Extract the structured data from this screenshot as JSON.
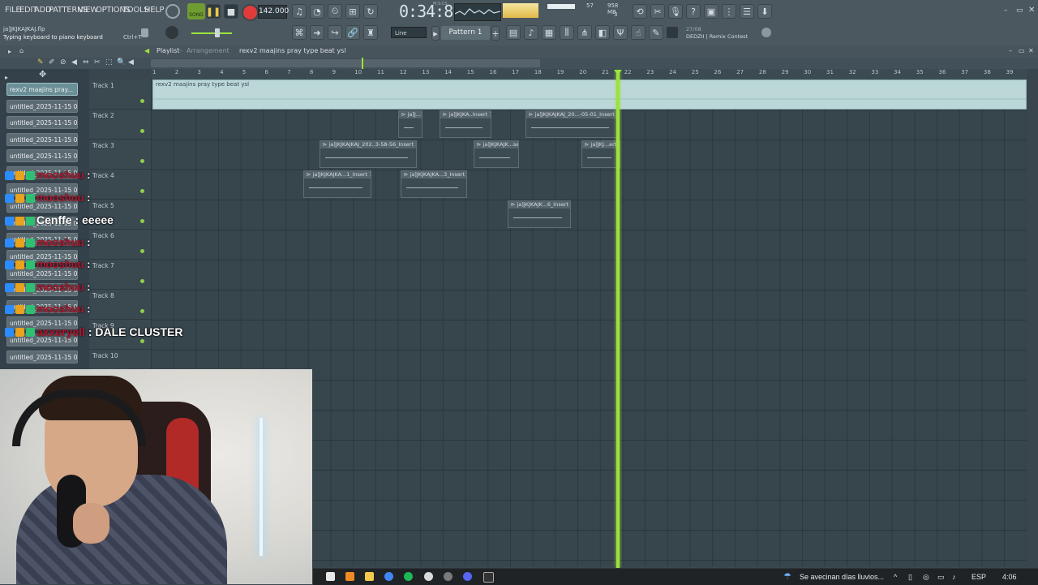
{
  "menu": [
    "FILE",
    "EDIT",
    "ADD",
    "PATTERNS",
    "VIEW",
    "OPTIONS",
    "TOOLS",
    "HELP"
  ],
  "transport": {
    "song_label": "SONG",
    "tempo": "142.000",
    "time": "0:34:81",
    "time_small": "M:S:CS"
  },
  "stats": {
    "memory": "958 MB",
    "cpu": "57",
    "voices": "3"
  },
  "project": {
    "filename": "ja]JKJKAJKAJ.flp",
    "hint": "Typing keyboard to piano keyboard",
    "shortcut": "Ctrl+T"
  },
  "pattern": {
    "snap": "Line",
    "name": "Pattern 1"
  },
  "news": {
    "date": "27/08",
    "text": "DEDZII | Remix Contest"
  },
  "playlist": {
    "title": "Playlist",
    "subtitle": "Arrangement",
    "breadcrumb": "rexv2  maajins  pray type beat ysl"
  },
  "ruler_ticks": [
    "1",
    "2",
    "3",
    "4",
    "5",
    "6",
    "7",
    "8",
    "9",
    "10",
    "11",
    "12",
    "13",
    "14",
    "15",
    "16",
    "17",
    "18",
    "19",
    "20",
    "21",
    "22",
    "23",
    "24",
    "25",
    "26",
    "27",
    "28",
    "29",
    "30",
    "31",
    "32",
    "33",
    "34",
    "35",
    "36",
    "37",
    "38",
    "39"
  ],
  "patterns": [
    {
      "label": "rexv2  maajins  pray..."
    },
    {
      "label": "untitled_2025-11-15 03-..."
    },
    {
      "label": "untitled_2025-11-15 03-..."
    },
    {
      "label": "untitled_2025-11-15 03-..."
    },
    {
      "label": "untitled_2025-11-15 03-..."
    },
    {
      "label": "untitled_2025-11-15 03-..."
    },
    {
      "label": "untitled_2025-11-15 03-..."
    },
    {
      "label": "untitled_2025-11-15 03-..."
    },
    {
      "label": "untitled_2025-11-15 03-..."
    },
    {
      "label": "untitled_2025-11-15 03-..."
    },
    {
      "label": "untitled_2025-11-15 03-..."
    },
    {
      "label": "untitled_2025-11-15 03-..."
    },
    {
      "label": "untitled_2025-11-15 03-..."
    },
    {
      "label": "untitled_2025-11-15 03-..."
    },
    {
      "label": "untitled_2025-11-15 03-..."
    },
    {
      "label": "untitled_2025-11-15 03-..."
    },
    {
      "label": "untitled_2025-11-15 03-..."
    }
  ],
  "tracks": [
    "Track 1",
    "Track 2",
    "Track 3",
    "Track 4",
    "Track 5",
    "Track 6",
    "Track 7",
    "Track 8",
    "Track 9",
    "Track 10"
  ],
  "clips": {
    "audio": "rexv2  maajins  pray type beat ysl",
    "c1": "ja]J...1",
    "c2": "ja]JKJKA..Insert 1",
    "c3": "ja]JKJKAJKAJ_20...-05-01_Insert 1",
    "c4": "ja]JKJKAJKAJ_202..3-58-56_Insert 1",
    "c5": "ja]JKJKAJK...sert 1",
    "c6": "ja]JKJ...ert 1",
    "c7": "ja]JKJKAJKA...1_Insert 1",
    "c8": "ja]JKJKAJKA...3_Insert 1",
    "c9": "ja]JKJKAJK...6_Insert 1"
  },
  "chat": [
    {
      "user": "mooshuu",
      "msg": ":"
    },
    {
      "user": "mooshuu",
      "msg": ":"
    },
    {
      "user": "Cenffe",
      "msg": ": eeeee"
    },
    {
      "user": "mooshuu",
      "msg": ":"
    },
    {
      "user": "mooshuu",
      "msg": ":"
    },
    {
      "user": "mooshuu",
      "msg": ":"
    },
    {
      "user": "mooshuu",
      "msg": ":"
    },
    {
      "user": "axxeryell",
      "msg": ": DALE CLUSTER"
    }
  ],
  "taskbar": {
    "weather": "Se avecinan días lluvios...",
    "lang": "ESP",
    "time": "4:06"
  }
}
